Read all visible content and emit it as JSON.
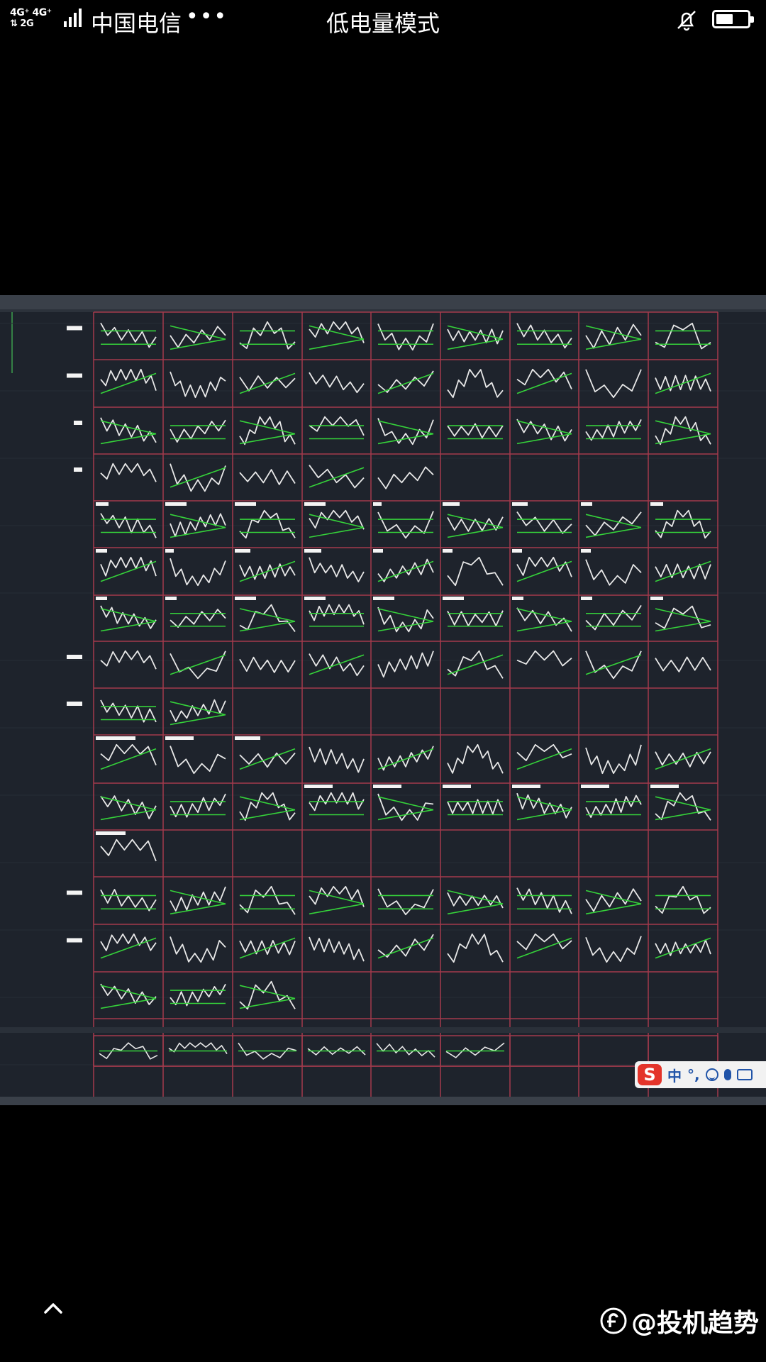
{
  "status_bar": {
    "network_line1": "4G⁺ 4G⁺",
    "network_line2": "⇅ 2G",
    "carrier": "中国电信",
    "more": "•••",
    "mode": "低电量模式",
    "battery_level": 0.55
  },
  "ime_bar": {
    "logo": "S",
    "lang": "中",
    "punct": "°,"
  },
  "watermark": {
    "text": "@投机趋势"
  },
  "colors": {
    "cad_background": "#1e232c",
    "grid_red": "#a33a4c",
    "pattern_white": "#e8e8e8",
    "trend_green": "#35d23a"
  }
}
